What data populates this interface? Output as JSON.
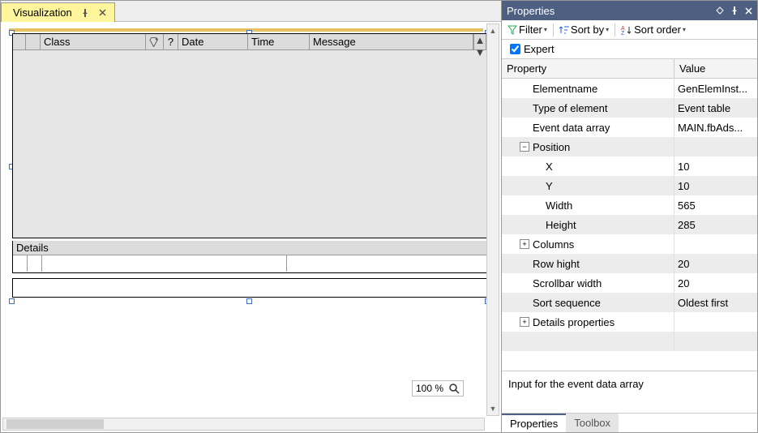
{
  "tab": {
    "title": "Visualization"
  },
  "event_table": {
    "columns": {
      "class": "Class",
      "date": "Date",
      "time": "Time",
      "message": "Message",
      "ack_icon": "ack-icon",
      "q_mark": "?"
    },
    "details_label": "Details"
  },
  "zoom": {
    "text": "100 %"
  },
  "panel": {
    "title": "Properties",
    "filter": "Filter",
    "sortby": "Sort by",
    "sortorder": "Sort order",
    "expert": "Expert",
    "head_property": "Property",
    "head_value": "Value",
    "footer": "Input for the event data array",
    "tabs": {
      "properties": "Properties",
      "toolbox": "Toolbox"
    }
  },
  "props": {
    "elementname": {
      "k": "Elementname",
      "v": "GenElemInst..."
    },
    "type": {
      "k": "Type of element",
      "v": "Event table"
    },
    "eventdata": {
      "k": "Event data array",
      "v": "MAIN.fbAds..."
    },
    "position": {
      "k": "Position"
    },
    "x": {
      "k": "X",
      "v": "10"
    },
    "y": {
      "k": "Y",
      "v": "10"
    },
    "width": {
      "k": "Width",
      "v": "565"
    },
    "height": {
      "k": "Height",
      "v": "285"
    },
    "columns": {
      "k": "Columns"
    },
    "rowheight": {
      "k": "Row hight",
      "v": "20"
    },
    "scrollw": {
      "k": "Scrollbar width",
      "v": "20"
    },
    "sortseq": {
      "k": "Sort sequence",
      "v": "Oldest first"
    },
    "detailsprops": {
      "k": "Details properties"
    }
  }
}
